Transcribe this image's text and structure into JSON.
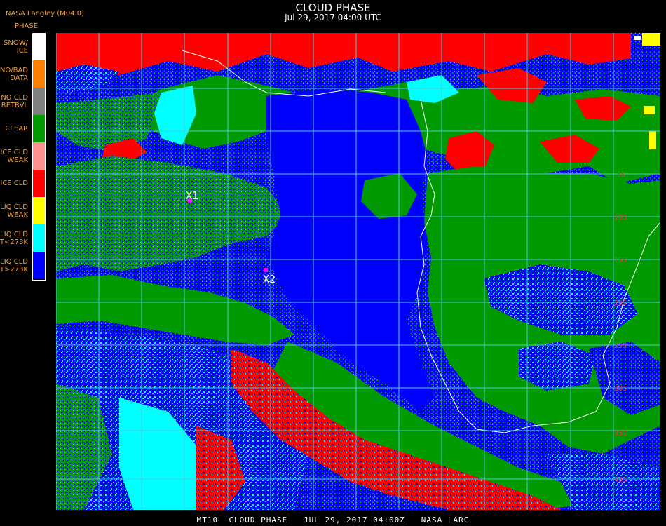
{
  "header": {
    "credit": "NASA Langley (M04.0)",
    "title": "CLOUD PHASE",
    "subtitle": "Jul 29, 2017 04:00 UTC"
  },
  "legend": {
    "title": "PHASE",
    "items": [
      {
        "label": "SNOW/\nICE",
        "color": "#ffffff"
      },
      {
        "label": "NO/BAD\nDATA",
        "color": "#ff8000"
      },
      {
        "label": "NO CLD\nRETRVL",
        "color": "#808080"
      },
      {
        "label": "CLEAR",
        "color": "#009a00"
      },
      {
        "label": "ICE CLD\nWEAK",
        "color": "#ff9090"
      },
      {
        "label": "ICE CLD",
        "color": "#ff0000"
      },
      {
        "label": "LIQ CLD\nWEAK",
        "color": "#ffff00"
      },
      {
        "label": "LIQ CLD\nT<273K",
        "color": "#00ffff"
      },
      {
        "label": "LIQ CLD\nT>273K",
        "color": "#0000ff"
      }
    ]
  },
  "map": {
    "markers": [
      {
        "label": "X1",
        "color": "#ff00ff"
      },
      {
        "label": "X2",
        "color": "#ff00ff"
      }
    ],
    "lat_labels": [
      "5S",
      "10S",
      "15S",
      "20S",
      "25S",
      "30S",
      "35S",
      "40S"
    ],
    "grid_color": "#50c8d8",
    "coast_color": "#ffffff"
  },
  "footer": {
    "text": "MT10  CLOUD PHASE   JUL 29, 2017 04:00Z   NASA LARC"
  }
}
